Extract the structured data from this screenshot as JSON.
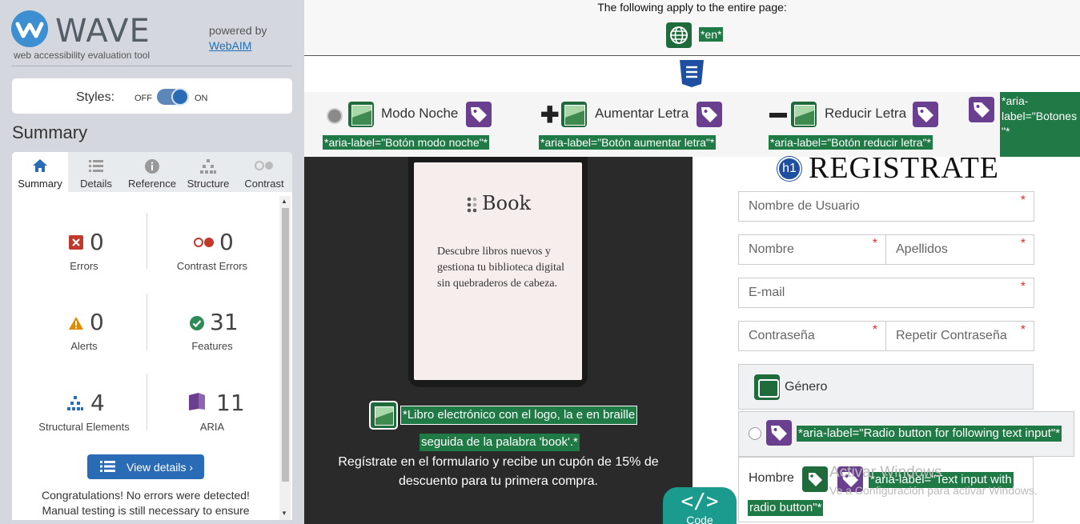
{
  "wave": {
    "title": "WAVE",
    "subtitle": "web accessibility evaluation tool",
    "powered_by": "powered by",
    "webaim_link": "WebAIM",
    "styles_label": "Styles:",
    "toggle_off": "OFF",
    "toggle_on": "ON",
    "summary_heading": "Summary",
    "tabs": [
      {
        "label": "Summary",
        "icon": "home-icon"
      },
      {
        "label": "Details",
        "icon": "list-icon"
      },
      {
        "label": "Reference",
        "icon": "info-icon"
      },
      {
        "label": "Structure",
        "icon": "structure-icon"
      },
      {
        "label": "Contrast",
        "icon": "contrast-icon"
      }
    ],
    "stats": {
      "errors": {
        "count": "0",
        "label": "Errors"
      },
      "contrast_errors": {
        "count": "0",
        "label": "Contrast Errors"
      },
      "alerts": {
        "count": "0",
        "label": "Alerts"
      },
      "features": {
        "count": "31",
        "label": "Features"
      },
      "structural": {
        "count": "4",
        "label": "Structural Elements"
      },
      "aria": {
        "count": "11",
        "label": "ARIA"
      }
    },
    "view_details": "View details ›",
    "congrats_line1": "Congratulations! No errors were detected!",
    "congrats_line2": "Manual testing is still necessary to ensure"
  },
  "page": {
    "apply_note": "The following apply to the entire page:",
    "lang_label": "*en*",
    "nav": {
      "night": "Modo Noche",
      "increase": "Aumentar Letra",
      "decrease": "Reducir Letra",
      "aria_night": "*aria-label=\"Botón modo noche\"*",
      "aria_increase": "*aria-label=\"Botón aumentar letra\"*",
      "aria_decrease": "*aria-label=\"Botón reducir letra\"*",
      "aria_buttons_1": "*aria-",
      "aria_buttons_2": "label=\"Botones",
      "aria_buttons_3": "\"*"
    },
    "book": {
      "brand": "Book",
      "description": "Descubre libros nuevos y gestiona tu biblioteca digital sin quebraderos de cabeza.",
      "alt_line1": "*Libro electrónico con el logo, la e en braille",
      "alt_line2": "seguida de la palabra 'book'.*",
      "promo": "Regístrate en el formulario y recibe un cupón de 15% de descuento para tu primera compra."
    },
    "code_button": {
      "glyph": "</>",
      "label": "Code"
    },
    "form": {
      "h1_badge": "h1",
      "heading": "REGISTRATE",
      "username_placeholder": "Nombre de Usuario",
      "name_placeholder": "Nombre",
      "surname_placeholder": "Apellidos",
      "email_placeholder": "E-mail",
      "password_placeholder": "Contraseña",
      "repeat_password_placeholder": "Repetir Contraseña",
      "required_mark": "*",
      "gender_legend": "Género",
      "radio_aria": "*aria-label=\"Radio button for following text input\"*",
      "hombre_label": "Hombre",
      "text_input_aria_1": "*aria-label=\"Text input with",
      "text_input_aria_2": "radio button\"*"
    },
    "watermark_1": "Activar Windows",
    "watermark_2": "Ve a Configuración para activar Windows."
  },
  "colors": {
    "wave_blue": "#2a6bb5",
    "wave_green": "#1f7a45",
    "aria_purple": "#6a3f8f",
    "error_red": "#c0392b",
    "alert_orange": "#e08a00"
  }
}
